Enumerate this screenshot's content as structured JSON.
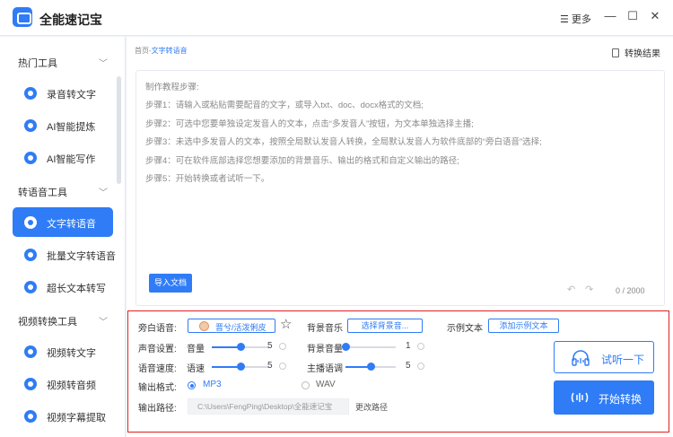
{
  "app": {
    "title": "全能速记宝",
    "more_label": "更多"
  },
  "sidebar": {
    "sections": [
      {
        "title": "热门工具",
        "items": [
          "录音转文字",
          "AI智能提炼",
          "AI智能写作"
        ]
      },
      {
        "title": "转语音工具",
        "items": [
          "文字转语音",
          "批量文字转语音",
          "超长文本转写"
        ]
      },
      {
        "title": "视频转换工具",
        "items": [
          "视频转文字",
          "视频转音频",
          "视频字幕提取"
        ]
      }
    ],
    "active_item": "文字转语音"
  },
  "main": {
    "breadcrumb_home": "首页",
    "breadcrumb_sep": "-",
    "breadcrumb_current": "文字转语音",
    "result_label": "转换结果",
    "steps": [
      "制作教程步骤:",
      "步骤1：请输入或粘贴需要配音的文字，或导入txt、doc、docx格式的文档;",
      "步骤2：可选中您要单独设定发音人的文本，点击“多发音人”按钮，为文本单独选择主播;",
      "步骤3：未选中多发音人的文本，按照全局默认发音人转换，全局默认发音人为软件底部的“旁白语音”选择;",
      "步骤4：可在软件底部选择您想要添加的背景音乐、输出的格式和自定义输出的路径;",
      "步骤5：开始转换或者试听一下。"
    ],
    "import_label": "导入文档",
    "char_count": "0 / 2000"
  },
  "settings": {
    "narration_label": "旁白语音:",
    "narration_voice": "晋兮/活泼俐皮",
    "bgm_label": "背景音乐",
    "bgm_button": "选择背景音...",
    "sample_label": "示例文本",
    "sample_button": "添加示例文本",
    "sound_label": "声音设置:",
    "volume_label": "音量",
    "volume_value": "5",
    "volume_level": 0.5,
    "bg_volume_label": "背景音量",
    "bg_volume_value": "1",
    "bg_volume_level": 0.0,
    "speed_section_label": "语音速度:",
    "speed_label": "语速",
    "speed_value": "5",
    "speed_level": 0.5,
    "pitch_label": "主播语调",
    "pitch_value": "5",
    "pitch_level": 0.5,
    "format_label": "输出格式:",
    "format_mp3": "MP3",
    "format_wav": "WAV",
    "selected_format": "MP3",
    "path_label": "输出路径:",
    "path_value": "C:\\Users\\FengPing\\Desktop\\全能速记宝",
    "change_path_label": "更改路径",
    "listen_button": "试听一下",
    "start_button": "开始转换"
  },
  "colors": {
    "accent": "#2f7cf6",
    "highlight_border": "#e02020"
  }
}
